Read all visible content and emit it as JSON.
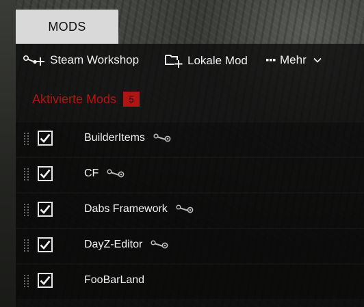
{
  "tab": {
    "label": "MODS"
  },
  "toolbar": {
    "workshop_label": "Steam Workshop",
    "local_label": "Lokale Mod",
    "more_label": "Mehr"
  },
  "section": {
    "title": "Aktivierte Mods",
    "count": "5"
  },
  "mods": [
    {
      "name": "BuilderItems",
      "checked": true,
      "steam": true
    },
    {
      "name": "CF",
      "checked": true,
      "steam": true
    },
    {
      "name": "Dabs Framework",
      "checked": true,
      "steam": true
    },
    {
      "name": "DayZ-Editor",
      "checked": true,
      "steam": true
    },
    {
      "name": "FooBarLand",
      "checked": true,
      "steam": false
    }
  ],
  "colors": {
    "accent": "#b01515",
    "tab_bg": "#d9d9d9",
    "text": "#f2f2f2"
  }
}
